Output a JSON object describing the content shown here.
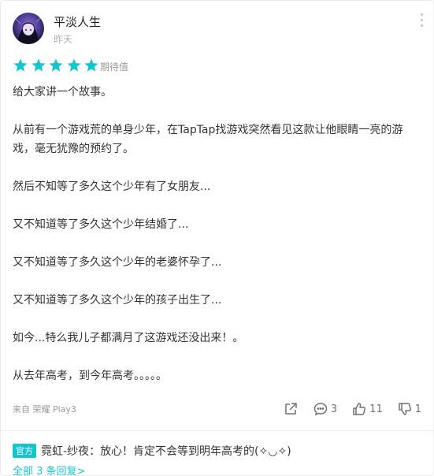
{
  "user": {
    "name": "平淡人生",
    "date": "昨天"
  },
  "rating": {
    "stars": 5,
    "max": 5,
    "label": "期待值",
    "color": "#15c5ce"
  },
  "content": {
    "paragraphs": [
      "给大家讲一个故事。",
      "从前有一个游戏荒的单身少年，在TapTap找游戏突然看见这款让他眼睛一亮的游戏，毫无犹豫的预约了。",
      "然后不知等了多久这个少年有了女朋友...",
      "又不知道等了多久这个少年结婚了...",
      "又不知道等了多久这个少年的老婆怀孕了...",
      "又不知道等了多久这个少年的孩子出生了...",
      "如今...特么我儿子都满月了这游戏还没出来！。",
      "从去年高考，到今年高考。。。。。"
    ]
  },
  "footer": {
    "device": "来自 荣耀 Play3",
    "share_icon": "share-icon",
    "comments_count": "3",
    "likes_count": "11",
    "dislikes_count": "1"
  },
  "reply": {
    "badge": "官方",
    "author": "霓虹-纱夜",
    "separator": "：",
    "text": "放心！肯定不会等到明年高考的(✧◡✧)"
  },
  "more_replies": "全部 3 条回复>",
  "colors": {
    "accent": "#15c5ce",
    "muted": "#9a9a9a"
  }
}
